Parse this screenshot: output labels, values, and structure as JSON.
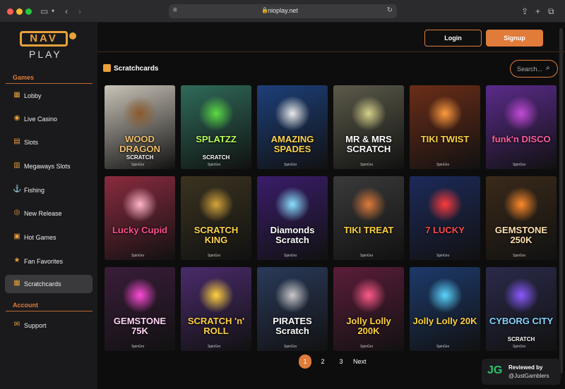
{
  "browser": {
    "url": "nioplay.net",
    "icon_lock": "lock-icon",
    "icon_reload": "reload-icon"
  },
  "logo": {
    "top": "NAV",
    "bottom": "PLAY"
  },
  "sidebar": {
    "games_title": "Games",
    "items": [
      {
        "label": "Lobby",
        "icon": "grid-icon"
      },
      {
        "label": "Live Casino",
        "icon": "live-icon"
      },
      {
        "label": "Slots",
        "icon": "slots-icon"
      },
      {
        "label": "Megaways Slots",
        "icon": "megaways-icon"
      },
      {
        "label": "Fishing",
        "icon": "fishing-icon"
      },
      {
        "label": "New Release",
        "icon": "new-release-icon"
      },
      {
        "label": "Hot Games",
        "icon": "hot-games-icon"
      },
      {
        "label": "Fan Favorites",
        "icon": "star-icon"
      },
      {
        "label": "Scratchcards",
        "icon": "grid-icon",
        "active": true
      }
    ],
    "account_title": "Account",
    "account_items": [
      {
        "label": "Support",
        "icon": "support-icon"
      }
    ]
  },
  "header": {
    "login": "Login",
    "signup": "Signup"
  },
  "main": {
    "title": "Scratchcards",
    "search_placeholder": "Search...",
    "cards": [
      {
        "title": "WOOD DRAGON",
        "sub": "SCRATCH",
        "bg": "#c9c3b8",
        "glow": "#8b5a2b",
        "color": "#f0c070"
      },
      {
        "title": "SPLATZZ",
        "sub": "SCRATCH",
        "bg": "#2f6b5a",
        "glow": "#5adb43",
        "color": "#b8ff5a"
      },
      {
        "title": "AMAZING SPADES",
        "sub": "",
        "bg": "#1d3f7a",
        "glow": "#eaeaea",
        "color": "#ffd54a"
      },
      {
        "title": "MR & MRS SCRATCH",
        "sub": "",
        "bg": "#5b5a4a",
        "glow": "#d6d18a",
        "color": "#ffffff"
      },
      {
        "title": "TIKI TWIST",
        "sub": "",
        "bg": "#6b2d18",
        "glow": "#ff9b3d",
        "color": "#ffd23f"
      },
      {
        "title": "funk'n DISCO",
        "sub": "",
        "bg": "#5a2b8a",
        "glow": "#c44bd6",
        "color": "#ff5fa2"
      },
      {
        "title": "Lucky Cupid",
        "sub": "",
        "bg": "#8a2b3f",
        "glow": "#ffb6c8",
        "color": "#ff4d8d"
      },
      {
        "title": "SCRATCH KING",
        "sub": "",
        "bg": "#3a3320",
        "glow": "#d4a43a",
        "color": "#ffd54a"
      },
      {
        "title": "Diamonds Scratch",
        "sub": "",
        "bg": "#3a1d6b",
        "glow": "#8ae0ff",
        "color": "#ffffff"
      },
      {
        "title": "TIKI TREAT",
        "sub": "",
        "bg": "#3a3a3a",
        "glow": "#e07b39",
        "color": "#ffd23f"
      },
      {
        "title": "7 LUCKY",
        "sub": "",
        "bg": "#1d2a5a",
        "glow": "#ff3b3b",
        "color": "#ff4a4a"
      },
      {
        "title": "GEMSTONE 250K",
        "sub": "",
        "bg": "#3a2a1a",
        "glow": "#ff8a2b",
        "color": "#ffe2b0"
      },
      {
        "title": "GEMSTONE 75K",
        "sub": "",
        "bg": "#3a1d3a",
        "glow": "#ff4bd6",
        "color": "#ffd6f6"
      },
      {
        "title": "SCRATCH 'n' ROLL",
        "sub": "",
        "bg": "#4a2b6b",
        "glow": "#ffd23f",
        "color": "#ffd23f"
      },
      {
        "title": "PIRATES Scratch",
        "sub": "",
        "bg": "#2a3a5a",
        "glow": "#c9c9c9",
        "color": "#ffffff"
      },
      {
        "title": "Jolly Lolly 200K",
        "sub": "",
        "bg": "#5a1d3a",
        "glow": "#ff5a8a",
        "color": "#ffd23f"
      },
      {
        "title": "Jolly Lolly 20K",
        "sub": "",
        "bg": "#1d3a6b",
        "glow": "#5ad6ff",
        "color": "#ffd23f"
      },
      {
        "title": "CYBORG CITY",
        "sub": "SCRATCH",
        "bg": "#2a2a4a",
        "glow": "#8a5aff",
        "color": "#8ad6ff"
      }
    ],
    "card_tag": "SpinGro"
  },
  "pagination": {
    "pages": [
      "1",
      "2",
      "3"
    ],
    "next": "Next",
    "current": "1"
  },
  "badge": {
    "logo": "JG",
    "line1": "Reviewed by",
    "line2": "@JustGamblers"
  },
  "colors": {
    "accent": "#e07b39",
    "sidebar_bg": "#1a1a1c",
    "page_bg": "#0d0d0d"
  }
}
